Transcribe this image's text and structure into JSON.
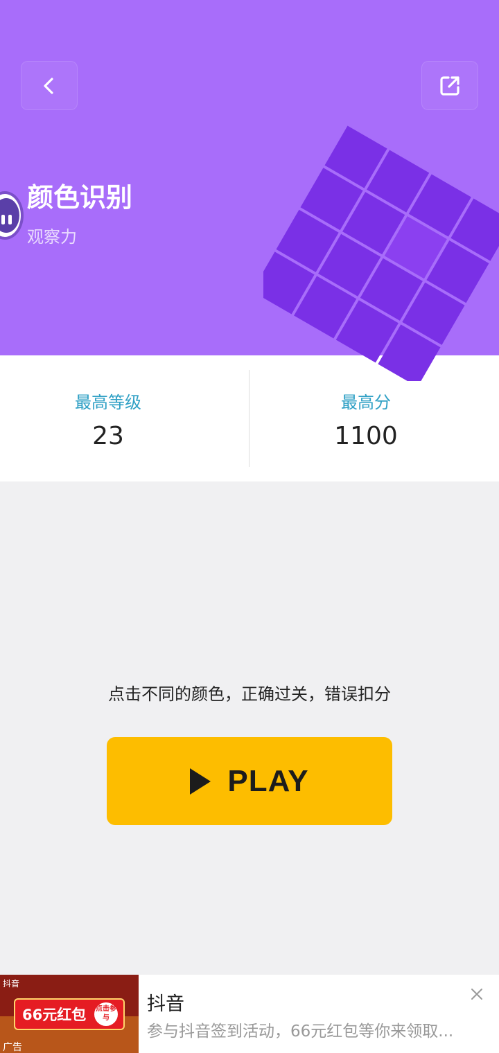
{
  "header": {
    "title": "颜色识别",
    "subtitle": "观察力",
    "background_color": "#a86dfa",
    "back_icon": "chevron-left-icon",
    "share_icon": "external-link-icon"
  },
  "stats": {
    "best_level_label": "最高等级",
    "best_level_value": "23",
    "best_score_label": "最高分",
    "best_score_value": "1100"
  },
  "game": {
    "hint": "点击不同的颜色，正确过关，错误扣分",
    "play_label": "PLAY",
    "play_color": "#fdbd00"
  },
  "ad": {
    "thumb_brand": "抖音",
    "thumb_amount": "66元红包",
    "thumb_join": "点击参与",
    "thumb_tag": "广告",
    "title": "抖音",
    "description": "参与抖音签到活动，66元红包等你来领取..."
  }
}
